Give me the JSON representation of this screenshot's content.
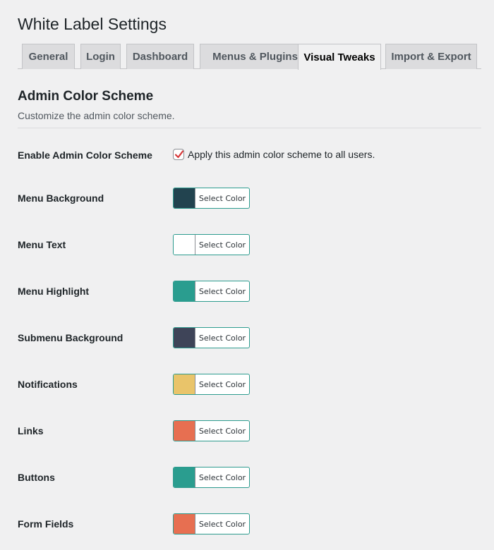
{
  "page": {
    "title": "White Label Settings"
  },
  "tabs": [
    {
      "label": "General",
      "active": false
    },
    {
      "label": "Login",
      "active": false
    },
    {
      "label": "Dashboard",
      "active": false
    },
    {
      "label": "Menus & Plugins",
      "active": false
    },
    {
      "label": "Visual Tweaks",
      "active": true
    },
    {
      "label": "Import & Export",
      "active": false
    }
  ],
  "section": {
    "title": "Admin Color Scheme",
    "description": "Customize the admin color scheme."
  },
  "enable": {
    "label": "Enable Admin Color Scheme",
    "checkbox_text": "Apply this admin color scheme to all users.",
    "checked": true,
    "check_color": "#d63638"
  },
  "select_color_label": "Select Color",
  "colors": [
    {
      "label": "Menu Background",
      "swatch": "#22434f"
    },
    {
      "label": "Menu Text",
      "swatch": "#ffffff"
    },
    {
      "label": "Menu Highlight",
      "swatch": "#2a9d8f"
    },
    {
      "label": "Submenu Background",
      "swatch": "#3e4458"
    },
    {
      "label": "Notifications",
      "swatch": "#e9c46a"
    },
    {
      "label": "Links",
      "swatch": "#e76f51"
    },
    {
      "label": "Buttons",
      "swatch": "#2a9d8f"
    },
    {
      "label": "Form Fields",
      "swatch": "#e76f51"
    }
  ]
}
